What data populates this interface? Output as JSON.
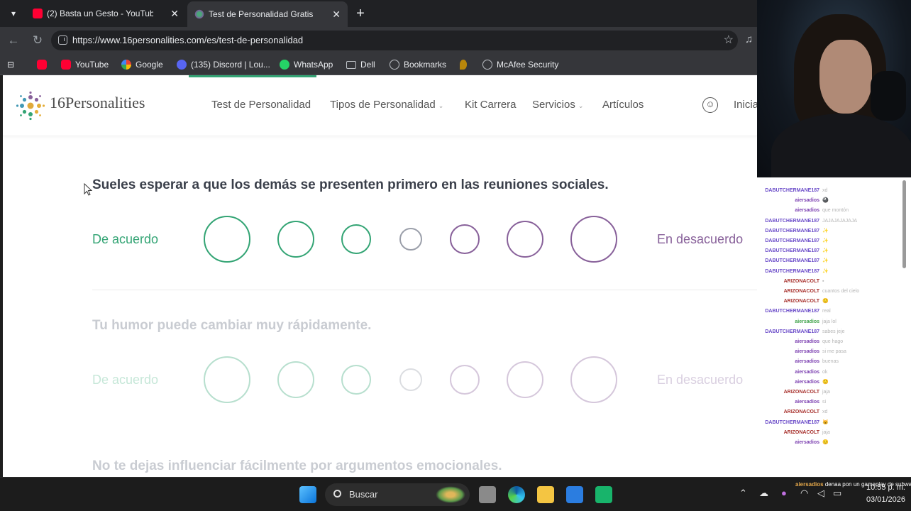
{
  "browser": {
    "tabs": [
      {
        "title": "(2) Basta un Gesto - YouTube",
        "icon": "youtube-icon"
      },
      {
        "title": "Test de Personalidad Gratis | 16Per",
        "icon": "16personalities-icon"
      }
    ],
    "url": "https://www.16personalities.com/es/test-de-personalidad",
    "bookmarks": [
      "YouTube",
      "Google",
      "(135) Discord | Lou...",
      "WhatsApp",
      "Dell",
      "Bookmarks",
      "McAfee Security"
    ]
  },
  "site": {
    "logo_text": "16Personalities",
    "nav": [
      "Test de Personalidad",
      "Tipos de Personalidad",
      "Kit Carrera",
      "Servicios",
      "Artículos"
    ],
    "login": "Inicia",
    "colors": {
      "agree": "#33a474",
      "disagree": "#88619a",
      "neutral": "#9b9faa"
    }
  },
  "questions": [
    {
      "text": "Sueles esperar a que los demás se presenten primero en las reuniones sociales.",
      "agree": "De acuerdo",
      "disagree": "En desacuerdo",
      "active": true
    },
    {
      "text": "Tu humor puede cambiar muy rápidamente.",
      "agree": "De acuerdo",
      "disagree": "En desacuerdo",
      "active": false
    },
    {
      "text": "No te dejas influenciar fácilmente por argumentos emocionales.",
      "active": false
    }
  ],
  "chat": [
    {
      "user": "DABUTCHERMANE187",
      "color": "#6b4cc9",
      "msg": "xd"
    },
    {
      "user": "aiersadios",
      "color": "#7b3fb0",
      "msg": "🎱"
    },
    {
      "user": "aiersadios",
      "color": "#7b3fb0",
      "msg": "que montón"
    },
    {
      "user": "DABUTCHERMANE187",
      "color": "#6b4cc9",
      "msg": "JAJAJAJAJAJA"
    },
    {
      "user": "DABUTCHERMANE187",
      "color": "#6b4cc9",
      "msg": "✨"
    },
    {
      "user": "DABUTCHERMANE187",
      "color": "#6b4cc9",
      "msg": "✨"
    },
    {
      "user": "DABUTCHERMANE187",
      "color": "#6b4cc9",
      "msg": "✨"
    },
    {
      "user": "DABUTCHERMANE187",
      "color": "#6b4cc9",
      "msg": "✨"
    },
    {
      "user": "DABUTCHERMANE187",
      "color": "#6b4cc9",
      "msg": "✨"
    },
    {
      "user": "ARIZONACOLT",
      "color": "#a8322e",
      "msg": "▪"
    },
    {
      "user": "ARIZONACOLT",
      "color": "#a8322e",
      "msg": "cuantos del cielo"
    },
    {
      "user": "ARIZONACOLT",
      "color": "#a8322e",
      "msg": "🙂"
    },
    {
      "user": "DABUTCHERMANE187",
      "color": "#6b4cc9",
      "msg": "real"
    },
    {
      "user": "aiersadios",
      "color": "#3fa24a",
      "msg": "jaja lol"
    },
    {
      "user": "DABUTCHERMANE187",
      "color": "#6b4cc9",
      "msg": "sabes jeje"
    },
    {
      "user": "aiersadios",
      "color": "#7b3fb0",
      "msg": "que hago"
    },
    {
      "user": "aiersadios",
      "color": "#7b3fb0",
      "msg": "si me pasa"
    },
    {
      "user": "aiersadios",
      "color": "#7b3fb0",
      "msg": "buenas"
    },
    {
      "user": "aiersadios",
      "color": "#7b3fb0",
      "msg": "ok"
    },
    {
      "user": "aiersadios",
      "color": "#7b3fb0",
      "msg": "🙂"
    },
    {
      "user": "ARIZONACOLT",
      "color": "#a8322e",
      "msg": "jaja"
    },
    {
      "user": "aiersadios",
      "color": "#7b3fb0",
      "msg": "si"
    },
    {
      "user": "ARIZONACOLT",
      "color": "#a8322e",
      "msg": "xd"
    },
    {
      "user": "DABUTCHERMANE187",
      "color": "#6b4cc9",
      "msg": "🐱"
    },
    {
      "user": "ARIZONACOLT",
      "color": "#a8322e",
      "msg": "jaja"
    },
    {
      "user": "aiersadios",
      "color": "#7b3fb0",
      "msg": "🙂"
    }
  ],
  "overlay": {
    "user": "aiersadios",
    "msg": "denaa pon un gameplay de subway"
  },
  "taskbar": {
    "search_placeholder": "Buscar",
    "time": "10:55 p. m.",
    "date": "03/01/2026"
  }
}
